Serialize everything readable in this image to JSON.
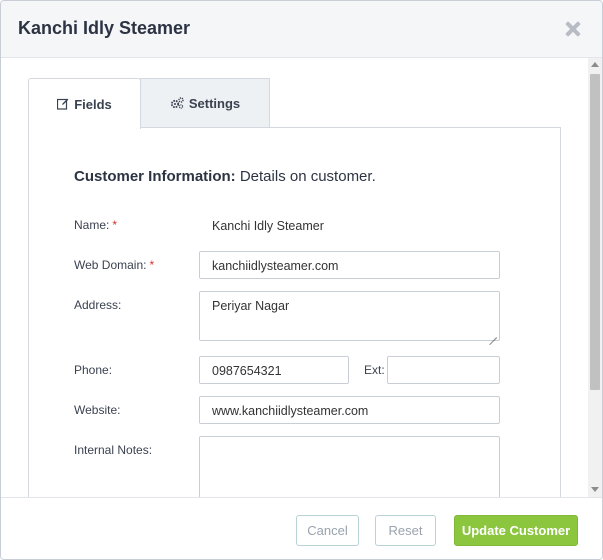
{
  "dialog": {
    "title": "Kanchi Idly Steamer"
  },
  "tabs": [
    {
      "label": "Fields",
      "icon": "edit-icon",
      "active": true
    },
    {
      "label": "Settings",
      "icon": "gears-icon",
      "active": false
    }
  ],
  "section": {
    "title_bold": "Customer Information:",
    "title_rest": "Details on customer."
  },
  "form": {
    "name_label": "Name:",
    "name_value": "Kanchi Idly Steamer",
    "web_domain_label": "Web Domain:",
    "web_domain_value": "kanchiidlysteamer.com",
    "address_label": "Address:",
    "address_value": "Periyar Nagar",
    "phone_label": "Phone:",
    "phone_value": "0987654321",
    "ext_label": "Ext:",
    "ext_value": "",
    "website_label": "Website:",
    "website_value": "www.kanchiidlysteamer.com",
    "notes_label": "Internal Notes:",
    "notes_value": "",
    "required_mark": "*"
  },
  "footer": {
    "cancel": "Cancel",
    "reset": "Reset",
    "update": "Update Customer"
  },
  "colors": {
    "accent": "#8cc63f",
    "required": "#d9312b"
  }
}
